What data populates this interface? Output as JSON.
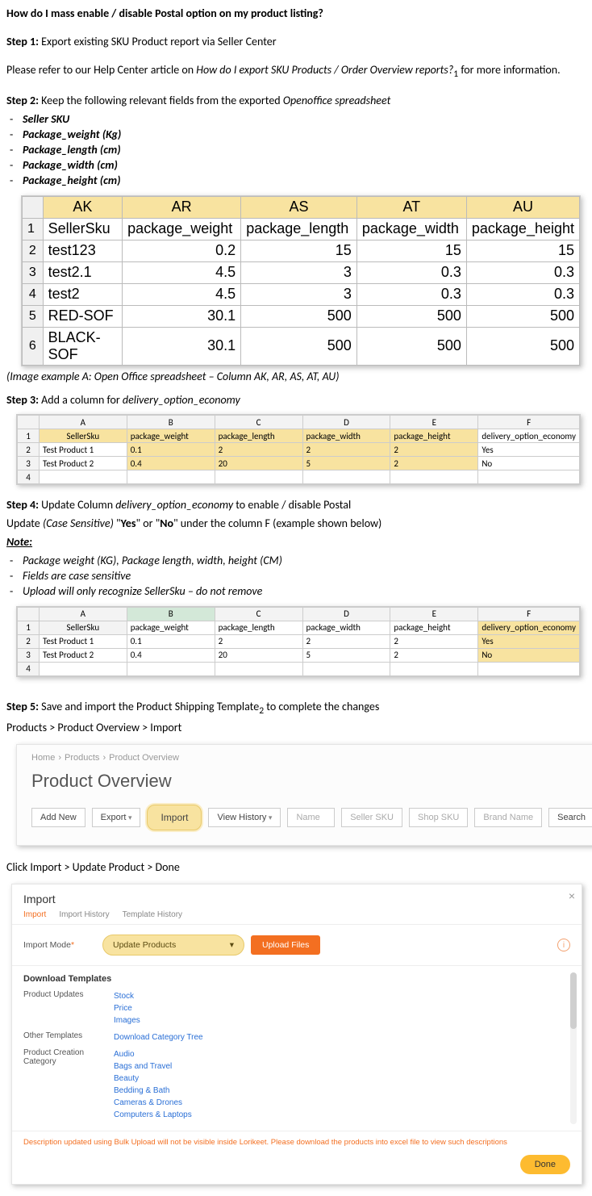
{
  "title": "How do I mass enable / disable Postal option on my product listing?",
  "step1": {
    "label": "Step 1:",
    "text": "Export existing SKU Product report via Seller Center",
    "refer_prefix": "Please refer to our Help Center article on ",
    "refer_link": "How do I export SKU Products / Order Overview reports?",
    "refer_sub": "1",
    "refer_suffix": " for more information."
  },
  "step2": {
    "label": "Step 2:",
    "text_prefix": "Keep the following relevant fields from the exported ",
    "text_italic": "Openoffice spreadsheet",
    "bullets": [
      "Seller SKU",
      "Package_weight (Kg)",
      "Package_length (cm)",
      "Package_width (cm)",
      "Package_height (cm)"
    ]
  },
  "spreadsheetA": {
    "cols": [
      "AK",
      "AR",
      "AS",
      "AT",
      "AU"
    ],
    "headers": [
      "SellerSku",
      "package_weight",
      "package_length",
      "package_width",
      "package_height"
    ],
    "rows": [
      {
        "n": "1"
      },
      {
        "n": "2",
        "c": [
          "test123",
          "0.2",
          "15",
          "15",
          "15"
        ]
      },
      {
        "n": "3",
        "c": [
          "test2.1",
          "4.5",
          "3",
          "0.3",
          "0.3"
        ]
      },
      {
        "n": "4",
        "c": [
          "test2",
          "4.5",
          "3",
          "0.3",
          "0.3"
        ]
      },
      {
        "n": "5",
        "c": [
          "RED-SOF",
          "30.1",
          "500",
          "500",
          "500"
        ]
      },
      {
        "n": "6",
        "c": [
          "BLACK-SOF",
          "30.1",
          "500",
          "500",
          "500"
        ]
      }
    ],
    "caption": "(Image example A: Open Office spreadsheet – Column AK, AR, AS, AT, AU)"
  },
  "step3": {
    "label": "Step 3:",
    "text_prefix": "Add a column for ",
    "text_italic": "delivery_option_economy"
  },
  "spreadsheetB": {
    "cols": [
      "A",
      "B",
      "C",
      "D",
      "E",
      "F"
    ],
    "headers": [
      "SellerSku",
      "package_weight",
      "package_length",
      "package_width",
      "package_height",
      "delivery_option_economy"
    ],
    "rows": [
      {
        "n": "2",
        "c": [
          "Test Product 1",
          "0.1",
          "2",
          "2",
          "2",
          "Yes"
        ]
      },
      {
        "n": "3",
        "c": [
          "Test Product 2",
          "0.4",
          "20",
          "5",
          "2",
          "No"
        ]
      },
      {
        "n": "4",
        "c": [
          "",
          "",
          "",
          "",
          "",
          ""
        ]
      }
    ]
  },
  "step4": {
    "label": "Step 4:",
    "line1_prefix": "Update Column ",
    "line1_italic": "delivery_option_economy",
    "line1_suffix": "  to enable / disable Postal",
    "line2_prefix": "Update ",
    "line2_italic": "(Case Sensitive)",
    "line2_mid1": " \"",
    "line2_yes": "Yes",
    "line2_mid2": "\" or \"",
    "line2_no": "No",
    "line2_suffix": "\" under the column F (example shown below)",
    "note_label": "Note:",
    "bullets": [
      "Package weight (KG), Package length, width, height (CM)",
      "Fields are case sensitive",
      "Upload will only recognize SellerSku – do not remove"
    ]
  },
  "spreadsheetC": {
    "cols": [
      "A",
      "B",
      "C",
      "D",
      "E",
      "F"
    ],
    "headers": [
      "SellerSku",
      "package_weight",
      "package_length",
      "package_width",
      "package_height",
      "delivery_option_economy"
    ],
    "rows": [
      {
        "n": "2",
        "c": [
          "Test Product 1",
          "0.1",
          "2",
          "2",
          "2",
          "Yes"
        ]
      },
      {
        "n": "3",
        "c": [
          "Test Product 2",
          "0.4",
          "20",
          "5",
          "2",
          "No"
        ]
      },
      {
        "n": "4",
        "c": [
          "",
          "",
          "",
          "",
          "",
          ""
        ]
      }
    ]
  },
  "step5": {
    "label": "Step 5:",
    "text_prefix": "Save and import the Product Shipping Template",
    "text_sub": "2",
    "text_suffix": " to complete the changes",
    "path": "Products > Product Overview > Import"
  },
  "productOverview": {
    "crumb": [
      "Home",
      "Products",
      "Product Overview"
    ],
    "title": "Product Overview",
    "buttons": {
      "add_new": "Add New",
      "export": "Export",
      "import": "Import",
      "view_history": "View History"
    },
    "inputs": {
      "name": "Name",
      "seller_sku": "Seller SKU",
      "shop_sku": "Shop SKU",
      "brand": "Brand Name"
    },
    "search": "Search"
  },
  "afterPO": "Click Import > Update Product > Done",
  "importModal": {
    "title": "Import",
    "tabs": [
      "Import",
      "Import History",
      "Template History"
    ],
    "mode_label": "Import Mode",
    "mode_value": "Update Products",
    "upload": "Upload Files",
    "dl_title": "Download Templates",
    "sections": [
      {
        "label": "Product Updates",
        "links": [
          "Stock",
          "Price",
          "Images"
        ]
      },
      {
        "label": "Other Templates",
        "links": [
          "Download Category Tree"
        ]
      },
      {
        "label": "Product Creation Category",
        "links": [
          "Audio",
          "Bags and Travel",
          "Beauty",
          "Bedding & Bath",
          "Cameras & Drones",
          "Computers & Laptops"
        ]
      }
    ],
    "warning": "Description updated using Bulk Upload will not be visible inside Lorikeet. Please download the products into excel file to view such descriptions",
    "done": "Done"
  }
}
